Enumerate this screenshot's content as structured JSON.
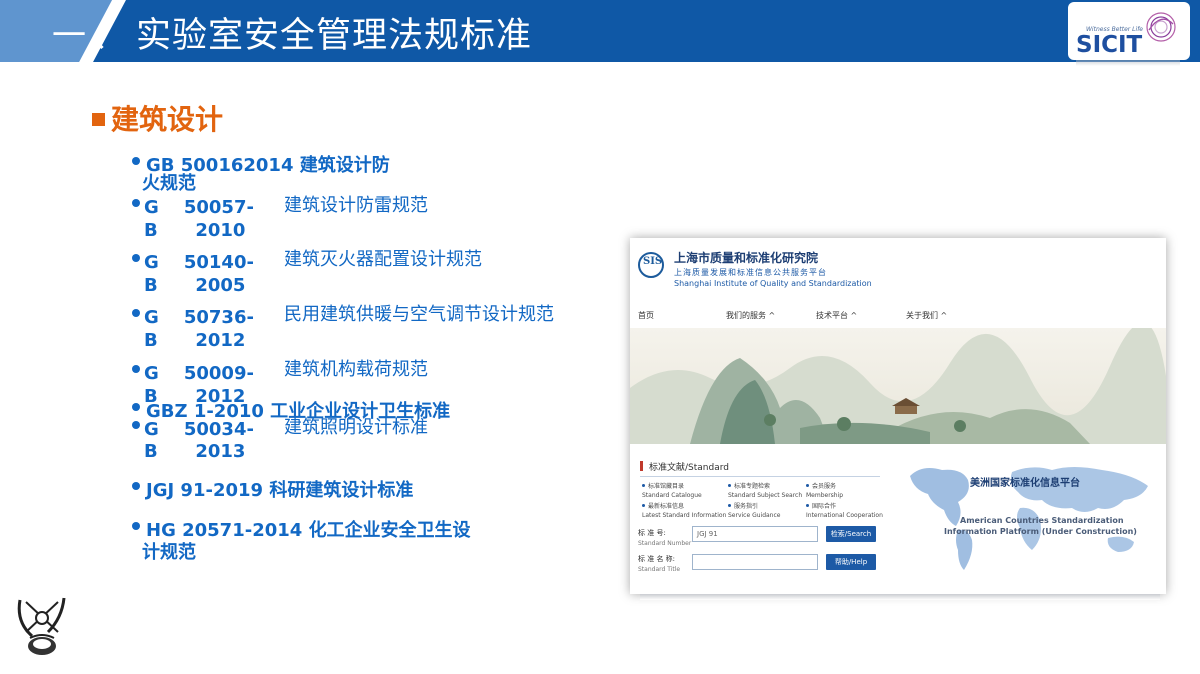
{
  "header": {
    "number": "一、",
    "title": "实验室安全管理法规标准"
  },
  "logo": {
    "tagline": "Witness Better Life",
    "name": "SICIT"
  },
  "section": {
    "heading": "建筑设计"
  },
  "standards": [
    {
      "line1": "GB 500162014  建筑设计防",
      "line2": "火规范"
    },
    {
      "code1": "G    50057-",
      "code2": "B      2010",
      "name": "建筑设计防雷规范"
    },
    {
      "code1": "G    50140-",
      "code2": "B      2005",
      "name": "建筑灭火器配置设计规范"
    },
    {
      "code1": "G    50736-",
      "code2": "B      2012",
      "name": "民用建筑供暖与空气调节设计规范"
    },
    {
      "code1": "G    50009-",
      "code2": "B      2012",
      "name": "建筑机构载荷规范"
    },
    {
      "line1": "GBZ 1-2010  工业企业设计卫生标准"
    },
    {
      "code1": "G    50034-",
      "code2": "B      2013",
      "name": "建筑照明设计标准"
    },
    {
      "line1": "JGJ 91-2019  科研建筑设计标准"
    },
    {
      "line1": "HG 20571-2014  化工企业安全卫生设",
      "line2": "计规范"
    }
  ],
  "website": {
    "logo_letters": "SIS",
    "title": "上海市质量和标准化研究院",
    "subtitle_cn": "上海质量发展和标准信息公共服务平台",
    "subtitle_en": "Shanghai Institute of Quality and Standardization",
    "nav": [
      "首页",
      "我们的服务 ^",
      "技术平台 ^",
      "关于我们 ^"
    ],
    "panel_title": "标准文献/Standard",
    "grid": [
      {
        "cn": "标准馆藏目录",
        "en": "Standard Catalogue"
      },
      {
        "cn": "标准专题检索",
        "en": "Standard Subject Search"
      },
      {
        "cn": "会员服务",
        "en": "Membership"
      },
      {
        "cn": "最新标准信息",
        "en": "Latest Standard Information"
      },
      {
        "cn": "服务指引",
        "en": "Service Guidance"
      },
      {
        "cn": "国际合作",
        "en": "International Cooperation"
      }
    ],
    "form": {
      "number_label": "标  准  号:",
      "number_label_en": "Standard Number",
      "number_value": "JGJ 91",
      "search_button": "检索/Search",
      "title_label": "标 准 名 称:",
      "title_label_en": "Standard Title",
      "title_value": "",
      "help_button": "帮助/Help"
    },
    "map_title": "美洲国家标准化信息平台",
    "map_en1": "American Countries Standardization",
    "map_en2": "Information Platform  (Under Construction)"
  },
  "colors": {
    "header_blue": "#0f58a6",
    "header_light": "#5f95cf",
    "heading_orange": "#e2640f",
    "list_blue": "#1268c4",
    "site_blue": "#1d5aa6"
  }
}
